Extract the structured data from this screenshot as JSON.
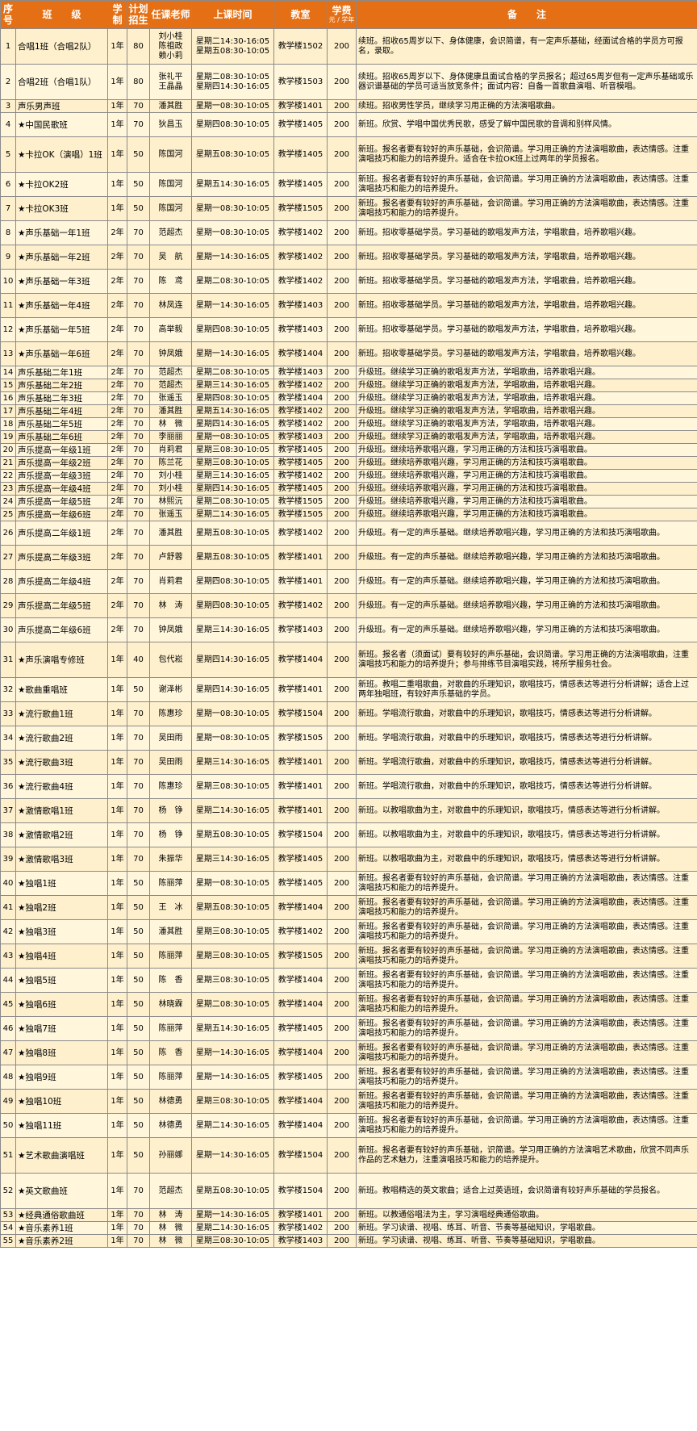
{
  "headers": {
    "no": "序号",
    "class": "班　　级",
    "term": "学制",
    "plan": "计划招生",
    "teacher": "任课老师",
    "time": "上课时间",
    "room": "教室",
    "fee": "学费",
    "fee_unit": "元 / 学年",
    "note": "备　　注"
  },
  "rows": [
    {
      "no": "1",
      "name": "合唱1班（合唱2队）",
      "term": "1年",
      "plan": "80",
      "teacher": "刘小桂\n陈祖政\n赖小莉",
      "time": "星期二14:30-16:05\n星期五08:30-10:05",
      "room": "教学楼1502",
      "fee": "200",
      "note": "续班。招收65周岁以下、身体健康，会识简谱，有一定声乐基础，经面试合格的学员方可报名，录取。"
    },
    {
      "no": "2",
      "name": "合唱2班（合唱1队）",
      "term": "1年",
      "plan": "80",
      "teacher": "张礼平\n王晶晶",
      "time": "星期二08:30-10:05\n星期四14:30-16:05",
      "room": "教学楼1503",
      "fee": "200",
      "note": "续班。招收65周岁以下、身体健康且面试合格的学员报名；超过65周岁但有一定声乐基础或乐器识谱基础的学员可适当放宽条件；面试内容：自备一首歌曲演唱、听音模唱。"
    },
    {
      "no": "3",
      "name": "声乐男声班",
      "term": "1年",
      "plan": "70",
      "teacher": "潘其胜",
      "time": "星期一08:30-10:05",
      "room": "教学楼1401",
      "fee": "200",
      "note": "续班。招收男性学员，继续学习用正确的方法演唱歌曲。"
    },
    {
      "no": "4",
      "name": "★中国民歌班",
      "term": "1年",
      "plan": "70",
      "teacher": "狄昌玉",
      "time": "星期四08:30-10:05",
      "room": "教学楼1405",
      "fee": "200",
      "note": "新班。欣赏、学唱中国优秀民歌，感受了解中国民歌的音调和别样风情。"
    },
    {
      "no": "5",
      "name": "★卡拉OK（演唱）1班",
      "term": "1年",
      "plan": "50",
      "teacher": "陈国河",
      "time": "星期五08:30-10:05",
      "room": "教学楼1405",
      "fee": "200",
      "note": "新班。报名者要有较好的声乐基础，会识简谱。学习用正确的方法演唱歌曲，表达情感。注重演唱技巧和能力的培养提升。适合在卡拉OK班上过两年的学员报名。"
    },
    {
      "no": "6",
      "name": "★卡拉OK2班",
      "term": "1年",
      "plan": "50",
      "teacher": "陈国河",
      "time": "星期五14:30-16:05",
      "room": "教学楼1405",
      "fee": "200",
      "note": "新班。报名者要有较好的声乐基础，会识简谱。学习用正确的方法演唱歌曲，表达情感。注重演唱技巧和能力的培养提升。"
    },
    {
      "no": "7",
      "name": "★卡拉OK3班",
      "term": "1年",
      "plan": "50",
      "teacher": "陈国河",
      "time": "星期一08:30-10:05",
      "room": "教学楼1505",
      "fee": "200",
      "note": "新班。报名者要有较好的声乐基础，会识简谱。学习用正确的方法演唱歌曲，表达情感。注重演唱技巧和能力的培养提升。"
    },
    {
      "no": "8",
      "name": "★声乐基础一年1班",
      "term": "2年",
      "plan": "70",
      "teacher": "范超杰",
      "time": "星期一08:30-10:05",
      "room": "教学楼1402",
      "fee": "200",
      "note": "新班。招收零基础学员。学习基础的歌唱发声方法，学唱歌曲，培养歌唱兴趣。"
    },
    {
      "no": "9",
      "name": "★声乐基础一年2班",
      "term": "2年",
      "plan": "70",
      "teacher": "吴　航",
      "time": "星期一14:30-16:05",
      "room": "教学楼1402",
      "fee": "200",
      "note": "新班。招收零基础学员。学习基础的歌唱发声方法，学唱歌曲，培养歌唱兴趣。"
    },
    {
      "no": "10",
      "name": "★声乐基础一年3班",
      "term": "2年",
      "plan": "70",
      "teacher": "陈　鸢",
      "time": "星期二08:30-10:05",
      "room": "教学楼1402",
      "fee": "200",
      "note": "新班。招收零基础学员。学习基础的歌唱发声方法，学唱歌曲，培养歌唱兴趣。"
    },
    {
      "no": "11",
      "name": "★声乐基础一年4班",
      "term": "2年",
      "plan": "70",
      "teacher": "林凤连",
      "time": "星期一14:30-16:05",
      "room": "教学楼1403",
      "fee": "200",
      "note": "新班。招收零基础学员。学习基础的歌唱发声方法，学唱歌曲，培养歌唱兴趣。"
    },
    {
      "no": "12",
      "name": "★声乐基础一年5班",
      "term": "2年",
      "plan": "70",
      "teacher": "高举毅",
      "time": "星期四08:30-10:05",
      "room": "教学楼1403",
      "fee": "200",
      "note": "新班。招收零基础学员。学习基础的歌唱发声方法，学唱歌曲，培养歌唱兴趣。"
    },
    {
      "no": "13",
      "name": "★声乐基础一年6班",
      "term": "2年",
      "plan": "70",
      "teacher": "钟凤娥",
      "time": "星期一14:30-16:05",
      "room": "教学楼1404",
      "fee": "200",
      "note": "新班。招收零基础学员。学习基础的歌唱发声方法，学唱歌曲，培养歌唱兴趣。"
    },
    {
      "no": "14",
      "name": "声乐基础二年1班",
      "term": "2年",
      "plan": "70",
      "teacher": "范超杰",
      "time": "星期二08:30-10:05",
      "room": "教学楼1403",
      "fee": "200",
      "note": "升级班。继续学习正确的歌唱发声方法，学唱歌曲，培养歌唱兴趣。"
    },
    {
      "no": "15",
      "name": "声乐基础二年2班",
      "term": "2年",
      "plan": "70",
      "teacher": "范超杰",
      "time": "星期三14:30-16:05",
      "room": "教学楼1402",
      "fee": "200",
      "note": "升级班。继续学习正确的歌唱发声方法，学唱歌曲，培养歌唱兴趣。"
    },
    {
      "no": "16",
      "name": "声乐基础二年3班",
      "term": "2年",
      "plan": "70",
      "teacher": "张遥玉",
      "time": "星期四08:30-10:05",
      "room": "教学楼1404",
      "fee": "200",
      "note": "升级班。继续学习正确的歌唱发声方法，学唱歌曲，培养歌唱兴趣。"
    },
    {
      "no": "17",
      "name": "声乐基础二年4班",
      "term": "2年",
      "plan": "70",
      "teacher": "潘其胜",
      "time": "星期五14:30-16:05",
      "room": "教学楼1402",
      "fee": "200",
      "note": "升级班。继续学习正确的歌唱发声方法，学唱歌曲，培养歌唱兴趣。"
    },
    {
      "no": "18",
      "name": "声乐基础二年5班",
      "term": "2年",
      "plan": "70",
      "teacher": "林　微",
      "time": "星期四14:30-16:05",
      "room": "教学楼1402",
      "fee": "200",
      "note": "升级班。继续学习正确的歌唱发声方法，学唱歌曲，培养歌唱兴趣。"
    },
    {
      "no": "19",
      "name": "声乐基础二年6班",
      "term": "2年",
      "plan": "70",
      "teacher": "李丽丽",
      "time": "星期一08:30-10:05",
      "room": "教学楼1403",
      "fee": "200",
      "note": "升级班。继续学习正确的歌唱发声方法，学唱歌曲，培养歌唱兴趣。"
    },
    {
      "no": "20",
      "name": "声乐提高一年级1班",
      "term": "2年",
      "plan": "70",
      "teacher": "肖莉君",
      "time": "星期三08:30-10:05",
      "room": "教学楼1405",
      "fee": "200",
      "note": "升级班。继续培养歌唱兴趣，学习用正确的方法和技巧演唱歌曲。"
    },
    {
      "no": "21",
      "name": "声乐提高一年级2班",
      "term": "2年",
      "plan": "70",
      "teacher": "陈兰花",
      "time": "星期三08:30-10:05",
      "room": "教学楼1405",
      "fee": "200",
      "note": "升级班。继续培养歌唱兴趣，学习用正确的方法和技巧演唱歌曲。"
    },
    {
      "no": "22",
      "name": "声乐提高一年级3班",
      "term": "2年",
      "plan": "70",
      "teacher": "刘小桂",
      "time": "星期三14:30-16:05",
      "room": "教学楼1402",
      "fee": "200",
      "note": "升级班。继续培养歌唱兴趣，学习用正确的方法和技巧演唱歌曲。"
    },
    {
      "no": "23",
      "name": "声乐提高一年级4班",
      "term": "2年",
      "plan": "70",
      "teacher": "刘小桂",
      "time": "星期四14:30-16:05",
      "room": "教学楼1405",
      "fee": "200",
      "note": "升级班。继续培养歌唱兴趣，学习用正确的方法和技巧演唱歌曲。"
    },
    {
      "no": "24",
      "name": "声乐提高一年级5班",
      "term": "2年",
      "plan": "70",
      "teacher": "林熙沅",
      "time": "星期二08:30-10:05",
      "room": "教学楼1505",
      "fee": "200",
      "note": "升级班。继续培养歌唱兴趣，学习用正确的方法和技巧演唱歌曲。"
    },
    {
      "no": "25",
      "name": "声乐提高一年级6班",
      "term": "2年",
      "plan": "70",
      "teacher": "张遥玉",
      "time": "星期二14:30-16:05",
      "room": "教学楼1505",
      "fee": "200",
      "note": "升级班。继续培养歌唱兴趣，学习用正确的方法和技巧演唱歌曲。"
    },
    {
      "no": "26",
      "name": "声乐提高二年级1班",
      "term": "2年",
      "plan": "70",
      "teacher": "潘其胜",
      "time": "星期五08:30-10:05",
      "room": "教学楼1402",
      "fee": "200",
      "note": "升级班。有一定的声乐基础。继续培养歌唱兴趣，学习用正确的方法和技巧演唱歌曲。"
    },
    {
      "no": "27",
      "name": "声乐提高二年级3班",
      "term": "2年",
      "plan": "70",
      "teacher": "卢舒蓉",
      "time": "星期五08:30-10:05",
      "room": "教学楼1401",
      "fee": "200",
      "note": "升级班。有一定的声乐基础。继续培养歌唱兴趣，学习用正确的方法和技巧演唱歌曲。"
    },
    {
      "no": "28",
      "name": "声乐提高二年级4班",
      "term": "2年",
      "plan": "70",
      "teacher": "肖莉君",
      "time": "星期四08:30-10:05",
      "room": "教学楼1401",
      "fee": "200",
      "note": "升级班。有一定的声乐基础。继续培养歌唱兴趣，学习用正确的方法和技巧演唱歌曲。"
    },
    {
      "no": "29",
      "name": "声乐提高二年级5班",
      "term": "2年",
      "plan": "70",
      "teacher": "林　涛",
      "time": "星期四08:30-10:05",
      "room": "教学楼1402",
      "fee": "200",
      "note": "升级班。有一定的声乐基础。继续培养歌唱兴趣，学习用正确的方法和技巧演唱歌曲。"
    },
    {
      "no": "30",
      "name": "声乐提高二年级6班",
      "term": "2年",
      "plan": "70",
      "teacher": "钟凤娥",
      "time": "星期三14:30-16:05",
      "room": "教学楼1403",
      "fee": "200",
      "note": "升级班。有一定的声乐基础。继续培养歌唱兴趣，学习用正确的方法和技巧演唱歌曲。"
    },
    {
      "no": "31",
      "name": "★声乐演唱专修班",
      "term": "1年",
      "plan": "40",
      "teacher": "包代崧",
      "time": "星期四14:30-16:05",
      "room": "教学楼1404",
      "fee": "200",
      "note": "新班。报名者（须面试）要有较好的声乐基础，会识简谱。学习用正确的方法演唱歌曲，注重演唱技巧和能力的培养提升；参与排练节目演唱实践，将所学服务社会。"
    },
    {
      "no": "32",
      "name": "★歌曲重唱班",
      "term": "1年",
      "plan": "50",
      "teacher": "谢泽彬",
      "time": "星期四14:30-16:05",
      "room": "教学楼1401",
      "fee": "200",
      "note": "新班。教唱二重唱歌曲，对歌曲的乐理知识，歌唱技巧，情感表达等进行分析讲解；适合上过两年独唱班，有较好声乐基础的学员。"
    },
    {
      "no": "33",
      "name": "★流行歌曲1班",
      "term": "1年",
      "plan": "70",
      "teacher": "陈惠珍",
      "time": "星期一08:30-10:05",
      "room": "教学楼1504",
      "fee": "200",
      "note": "新班。学唱流行歌曲，对歌曲中的乐理知识，歌唱技巧，情感表达等进行分析讲解。"
    },
    {
      "no": "34",
      "name": "★流行歌曲2班",
      "term": "1年",
      "plan": "70",
      "teacher": "吴田雨",
      "time": "星期一08:30-10:05",
      "room": "教学楼1505",
      "fee": "200",
      "note": "新班。学唱流行歌曲，对歌曲中的乐理知识，歌唱技巧，情感表达等进行分析讲解。"
    },
    {
      "no": "35",
      "name": "★流行歌曲3班",
      "term": "1年",
      "plan": "70",
      "teacher": "吴田雨",
      "time": "星期三14:30-16:05",
      "room": "教学楼1401",
      "fee": "200",
      "note": "新班。学唱流行歌曲，对歌曲中的乐理知识，歌唱技巧，情感表达等进行分析讲解。"
    },
    {
      "no": "36",
      "name": "★流行歌曲4班",
      "term": "1年",
      "plan": "70",
      "teacher": "陈惠珍",
      "time": "星期三08:30-10:05",
      "room": "教学楼1401",
      "fee": "200",
      "note": "新班。学唱流行歌曲，对歌曲中的乐理知识，歌唱技巧，情感表达等进行分析讲解。"
    },
    {
      "no": "37",
      "name": "★激情歌唱1班",
      "term": "1年",
      "plan": "70",
      "teacher": "杨　铮",
      "time": "星期二14:30-16:05",
      "room": "教学楼1401",
      "fee": "200",
      "note": "新班。以教唱歌曲为主，对歌曲中的乐理知识，歌唱技巧，情感表达等进行分析讲解。"
    },
    {
      "no": "38",
      "name": "★激情歌唱2班",
      "term": "1年",
      "plan": "70",
      "teacher": "杨　铮",
      "time": "星期五08:30-10:05",
      "room": "教学楼1504",
      "fee": "200",
      "note": "新班。以教唱歌曲为主，对歌曲中的乐理知识，歌唱技巧，情感表达等进行分析讲解。"
    },
    {
      "no": "39",
      "name": "★激情歌唱3班",
      "term": "1年",
      "plan": "70",
      "teacher": "朱振华",
      "time": "星期三14:30-16:05",
      "room": "教学楼1405",
      "fee": "200",
      "note": "新班。以教唱歌曲为主，对歌曲中的乐理知识，歌唱技巧，情感表达等进行分析讲解。"
    },
    {
      "no": "40",
      "name": "★独唱1班",
      "term": "1年",
      "plan": "50",
      "teacher": "陈丽萍",
      "time": "星期一08:30-10:05",
      "room": "教学楼1405",
      "fee": "200",
      "note": "新班。报名者要有较好的声乐基础，会识简谱。学习用正确的方法演唱歌曲，表达情感。注重演唱技巧和能力的培养提升。"
    },
    {
      "no": "41",
      "name": "★独唱2班",
      "term": "1年",
      "plan": "50",
      "teacher": "王　冰",
      "time": "星期五08:30-10:05",
      "room": "教学楼1404",
      "fee": "200",
      "note": "新班。报名者要有较好的声乐基础，会识简谱。学习用正确的方法演唱歌曲，表达情感。注重演唱技巧和能力的培养提升。"
    },
    {
      "no": "42",
      "name": "★独唱3班",
      "term": "1年",
      "plan": "50",
      "teacher": "潘其胜",
      "time": "星期三08:30-10:05",
      "room": "教学楼1402",
      "fee": "200",
      "note": "新班。报名者要有较好的声乐基础，会识简谱。学习用正确的方法演唱歌曲，表达情感。注重演唱技巧和能力的培养提升。"
    },
    {
      "no": "43",
      "name": "★独唱4班",
      "term": "1年",
      "plan": "50",
      "teacher": "陈丽萍",
      "time": "星期三08:30-10:05",
      "room": "教学楼1505",
      "fee": "200",
      "note": "新班。报名者要有较好的声乐基础，会识简谱。学习用正确的方法演唱歌曲，表达情感。注重演唱技巧和能力的培养提升。"
    },
    {
      "no": "44",
      "name": "★独唱5班",
      "term": "1年",
      "plan": "50",
      "teacher": "陈　香",
      "time": "星期三08:30-10:05",
      "room": "教学楼1404",
      "fee": "200",
      "note": "新班。报名者要有较好的声乐基础，会识简谱。学习用正确的方法演唱歌曲，表达情感。注重演唱技巧和能力的培养提升。"
    },
    {
      "no": "45",
      "name": "★独唱6班",
      "term": "1年",
      "plan": "50",
      "teacher": "林晓霖",
      "time": "星期二08:30-10:05",
      "room": "教学楼1404",
      "fee": "200",
      "note": "新班。报名者要有较好的声乐基础，会识简谱。学习用正确的方法演唱歌曲，表达情感。注重演唱技巧和能力的培养提升。"
    },
    {
      "no": "46",
      "name": "★独唱7班",
      "term": "1年",
      "plan": "50",
      "teacher": "陈丽萍",
      "time": "星期五14:30-16:05",
      "room": "教学楼1405",
      "fee": "200",
      "note": "新班。报名者要有较好的声乐基础，会识简谱。学习用正确的方法演唱歌曲，表达情感。注重演唱技巧和能力的培养提升。"
    },
    {
      "no": "47",
      "name": "★独唱8班",
      "term": "1年",
      "plan": "50",
      "teacher": "陈　香",
      "time": "星期一14:30-16:05",
      "room": "教学楼1404",
      "fee": "200",
      "note": "新班。报名者要有较好的声乐基础，会识简谱。学习用正确的方法演唱歌曲，表达情感。注重演唱技巧和能力的培养提升。"
    },
    {
      "no": "48",
      "name": "★独唱9班",
      "term": "1年",
      "plan": "50",
      "teacher": "陈丽萍",
      "time": "星期一14:30-16:05",
      "room": "教学楼1405",
      "fee": "200",
      "note": "新班。报名者要有较好的声乐基础，会识简谱。学习用正确的方法演唱歌曲，表达情感。注重演唱技巧和能力的培养提升。"
    },
    {
      "no": "49",
      "name": "★独唱10班",
      "term": "1年",
      "plan": "50",
      "teacher": "林德勇",
      "time": "星期三08:30-10:05",
      "room": "教学楼1404",
      "fee": "200",
      "note": "新班。报名者要有较好的声乐基础，会识简谱。学习用正确的方法演唱歌曲，表达情感。注重演唱技巧和能力的培养提升。"
    },
    {
      "no": "50",
      "name": "★独唱11班",
      "term": "1年",
      "plan": "50",
      "teacher": "林德勇",
      "time": "星期二14:30-16:05",
      "room": "教学楼1404",
      "fee": "200",
      "note": "新班。报名者要有较好的声乐基础，会识简谱。学习用正确的方法演唱歌曲，表达情感。注重演唱技巧和能力的培养提升。"
    },
    {
      "no": "51",
      "name": "★艺术歌曲演唱班",
      "term": "1年",
      "plan": "50",
      "teacher": "孙丽娜",
      "time": "星期一14:30-16:05",
      "room": "教学楼1504",
      "fee": "200",
      "note": "新班。报名者要有较好的声乐基础，识简谱。学习用正确的方法演唱艺术歌曲，欣赏不同声乐作品的艺术魅力，注重演唱技巧和能力的培养提升。"
    },
    {
      "no": "52",
      "name": "★英文歌曲班",
      "term": "1年",
      "plan": "70",
      "teacher": "范超杰",
      "time": "星期五08:30-10:05",
      "room": "教学楼1504",
      "fee": "200",
      "note": "新班。教唱精选的英文歌曲；适合上过英语班，会识简谱有较好声乐基础的学员报名。"
    },
    {
      "no": "53",
      "name": "★经典通俗歌曲班",
      "term": "1年",
      "plan": "70",
      "teacher": "林　涛",
      "time": "星期一14:30-16:05",
      "room": "教学楼1401",
      "fee": "200",
      "note": "新班。以教通俗唱法为主，学习演唱经典通俗歌曲。"
    },
    {
      "no": "54",
      "name": "★音乐素养1班",
      "term": "1年",
      "plan": "70",
      "teacher": "林　微",
      "time": "星期二14:30-16:05",
      "room": "教学楼1402",
      "fee": "200",
      "note": "新班。学习读谱、视唱、练耳、听音、节奏等基础知识，学唱歌曲。"
    },
    {
      "no": "55",
      "name": "★音乐素养2班",
      "term": "1年",
      "plan": "70",
      "teacher": "林　微",
      "time": "星期三08:30-10:05",
      "room": "教学楼1403",
      "fee": "200",
      "note": "新班。学习读谱、视唱、练耳、听音、节奏等基础知识，学唱歌曲。"
    }
  ]
}
